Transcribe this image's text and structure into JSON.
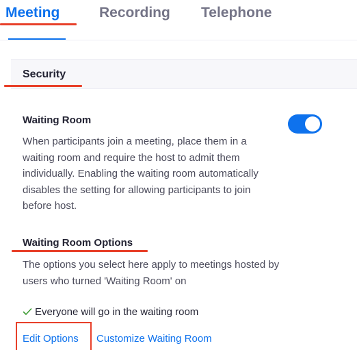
{
  "tabs": [
    {
      "label": "Meeting",
      "active": true
    },
    {
      "label": "Recording",
      "active": false
    },
    {
      "label": "Telephone",
      "active": false
    }
  ],
  "section": {
    "title": "Security"
  },
  "waiting_room": {
    "title": "Waiting Room",
    "description": "When participants join a meeting, place them in a waiting room and require the host to admit them individually. Enabling the waiting room automatically disables the setting for allowing participants to join before host.",
    "enabled": true
  },
  "options": {
    "title": "Waiting Room Options",
    "description": "The options you select here apply to meetings hosted by users who turned 'Waiting Room' on",
    "selected": "Everyone will go in the waiting room",
    "edit_label": "Edit Options",
    "customize_label": "Customize Waiting Room"
  },
  "colors": {
    "accent": "#0e72ed",
    "annotation": "#e8402a"
  }
}
